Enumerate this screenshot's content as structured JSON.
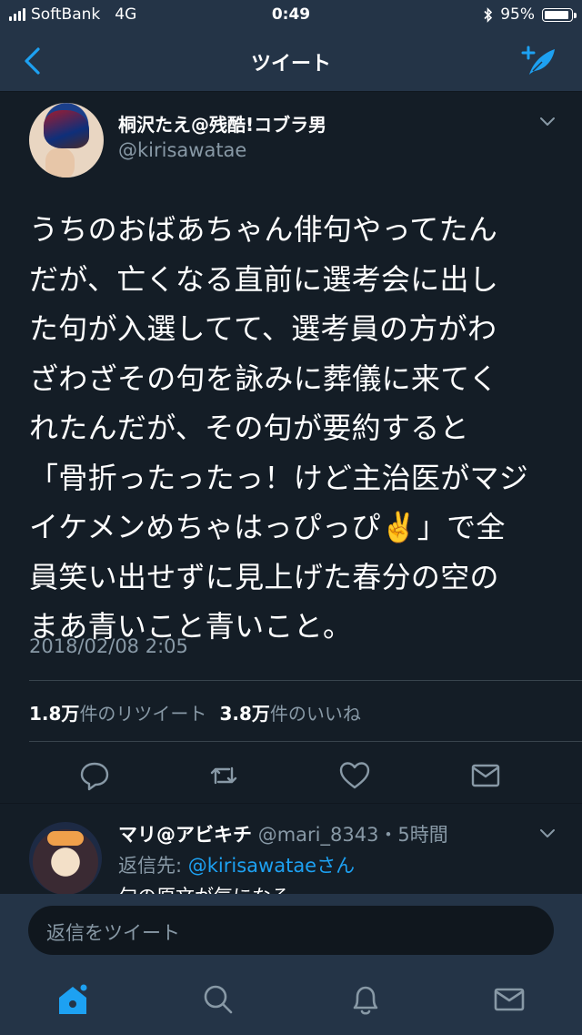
{
  "status_bar": {
    "carrier": "SoftBank",
    "network": "4G",
    "time": "0:49",
    "battery": "95%",
    "battery_level": 0.95
  },
  "nav": {
    "title": "ツイート",
    "back_icon": "chevron-left-icon",
    "compose_icon": "compose-tweet-icon"
  },
  "tweet": {
    "display_name": "桐沢たえ@残酷!コブラ男",
    "handle": "@kirisawatae",
    "text": "うちのおばあちゃん俳句やってたん\nだが、亡くなる直前に選考会に出し\nた句が入選してて、選考員の方がわ\nざわざその句を詠みに葬儀に来てく\nれたんだが、その句が要約すると\n「骨折ったったっ！けど主治医がマジ\nイケメンめちゃはっぴっぴ✌️」で全\n員笑い出せずに見上げた春分の空の\nまあ青いこと青いこと。",
    "timestamp": "2018/02/08 2:05",
    "retweet_count": "1.8万",
    "retweet_label": "件のリツイート",
    "like_count": "3.8万",
    "like_label": "件のいいね"
  },
  "reply": {
    "display_name": "マリ@アビキチ",
    "handle": "@mari_8343",
    "time_ago": "・5時間",
    "reply_to_prefix": "返信先: ",
    "reply_to_handle": "@kirisawataeさん",
    "text": "句の原文が気になる"
  },
  "composer": {
    "placeholder": "返信をツイート"
  },
  "tabs": [
    "home-icon",
    "search-icon",
    "notifications-icon",
    "messages-icon"
  ],
  "colors": {
    "background": "#141d26",
    "bar": "#243447",
    "accent": "#1da1f2",
    "secondary_text": "#8899a6"
  }
}
